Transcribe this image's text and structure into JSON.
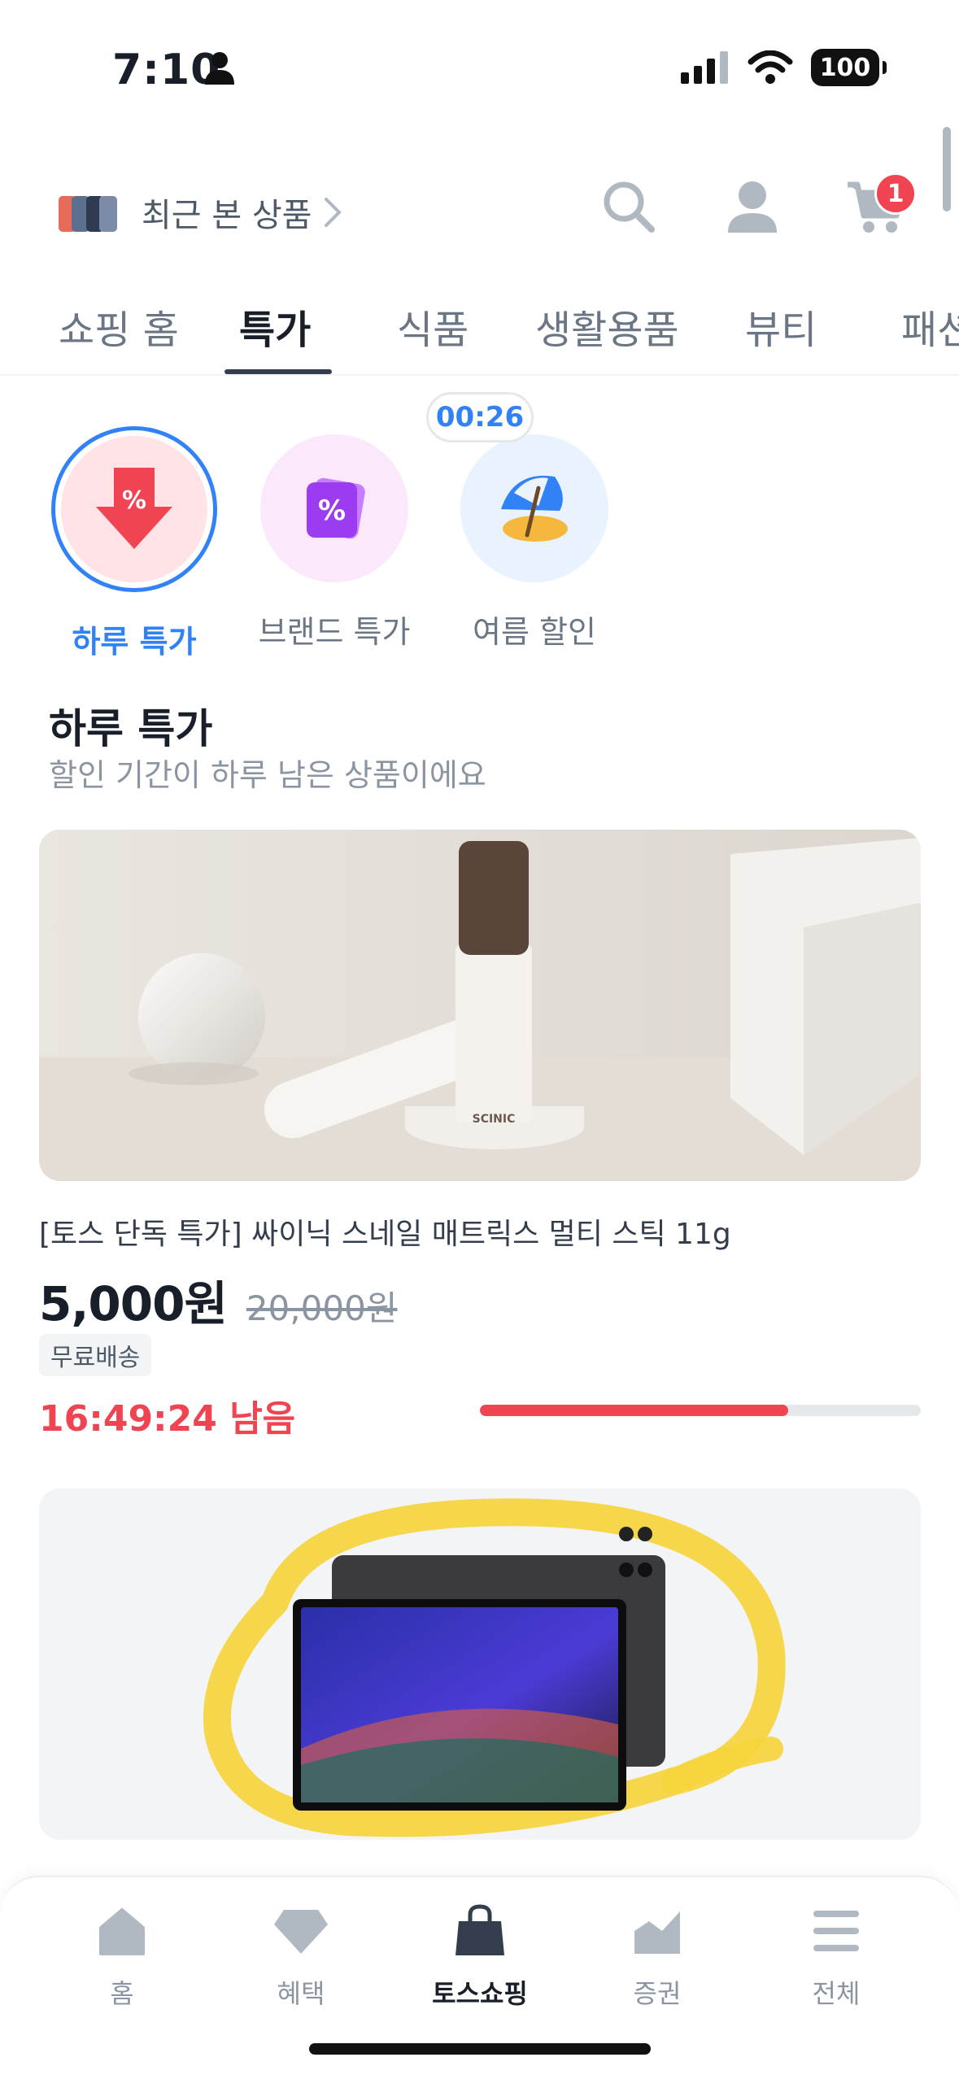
{
  "status_bar": {
    "time": "7:10",
    "battery": "100"
  },
  "header": {
    "recent_label": "최근 본 상품",
    "cart_count": "1"
  },
  "tabs": [
    {
      "label": "쇼핑 홈"
    },
    {
      "label": "특가"
    },
    {
      "label": "식품"
    },
    {
      "label": "생활용품"
    },
    {
      "label": "뷰티"
    },
    {
      "label": "패션"
    }
  ],
  "active_tab": "특가",
  "categories": [
    {
      "label": "하루 특가",
      "icon": "red-down-arrow-percent-icon"
    },
    {
      "label": "브랜드 특가",
      "icon": "purple-percent-card-icon"
    },
    {
      "label": "여름 할인",
      "icon": "beach-umbrella-icon"
    }
  ],
  "category_timer": "00:26",
  "section": {
    "title": "하루 특가",
    "subtitle": "할인 기간이 하루 남은 상품이에요"
  },
  "product": {
    "name": "[토스 단독 특가] 싸이닉 스네일 매트릭스 멀티 스틱 11g",
    "price": "5,000원",
    "original_price": "20,000원",
    "shipping_badge": "무료배송",
    "time_remaining": "16:49:24 남음",
    "sold_progress": 0.7,
    "product_brand_text": "SCINIC"
  },
  "bottom_nav": [
    {
      "label": "홈"
    },
    {
      "label": "혜택"
    },
    {
      "label": "토스쇼핑"
    },
    {
      "label": "증권"
    },
    {
      "label": "전체"
    }
  ],
  "colors": {
    "accent_blue": "#3182f6",
    "sale_red": "#f04452",
    "text_primary": "#191f28",
    "text_secondary": "#8b95a1"
  }
}
